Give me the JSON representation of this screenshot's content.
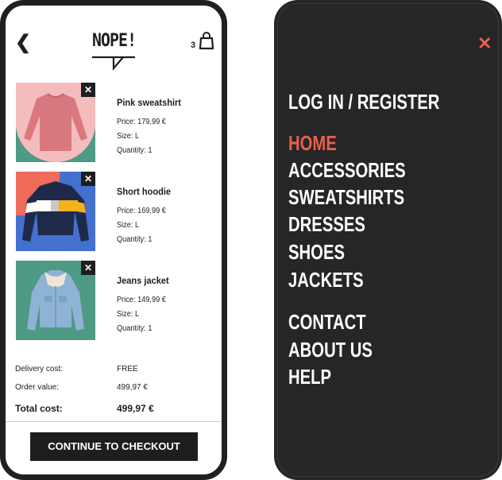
{
  "cart": {
    "logo": "NOPE!",
    "cart_count": "3",
    "items": [
      {
        "name": "Pink sweatshirt",
        "price": "Price: 179,99 €",
        "size": "Size: L",
        "quantity": "Quantity: 1"
      },
      {
        "name": "Short hoodie",
        "price": "Price: 169,99 €",
        "size": "Size: L",
        "quantity": "Quantity: 1"
      },
      {
        "name": "Jeans jacket",
        "price": "Price: 149,99 €",
        "size": "Size: L",
        "quantity": "Quantity: 1"
      }
    ],
    "summary": {
      "delivery_label": "Delivery cost:",
      "delivery_value": "FREE",
      "order_label": "Order value:",
      "order_value": "499,97 €",
      "total_label": "Total cost:",
      "total_value": "499,97 €"
    },
    "checkout_label": "CONTINUE TO CHECKOUT"
  },
  "menu": {
    "login": "LOG IN / REGISTER",
    "categories": [
      "HOME",
      "ACCESSORIES",
      "SWEATSHIRTS",
      "DRESSES",
      "SHOES",
      "JACKETS"
    ],
    "links": [
      "CONTACT",
      "ABOUT US",
      "HELP"
    ],
    "active_color": "#e8604f"
  },
  "colors": {
    "dark": "#1e1e1e",
    "accent": "#e8604f",
    "pink": "#f4bcbc",
    "teal": "#4d9a85",
    "blue": "#4470d0"
  }
}
